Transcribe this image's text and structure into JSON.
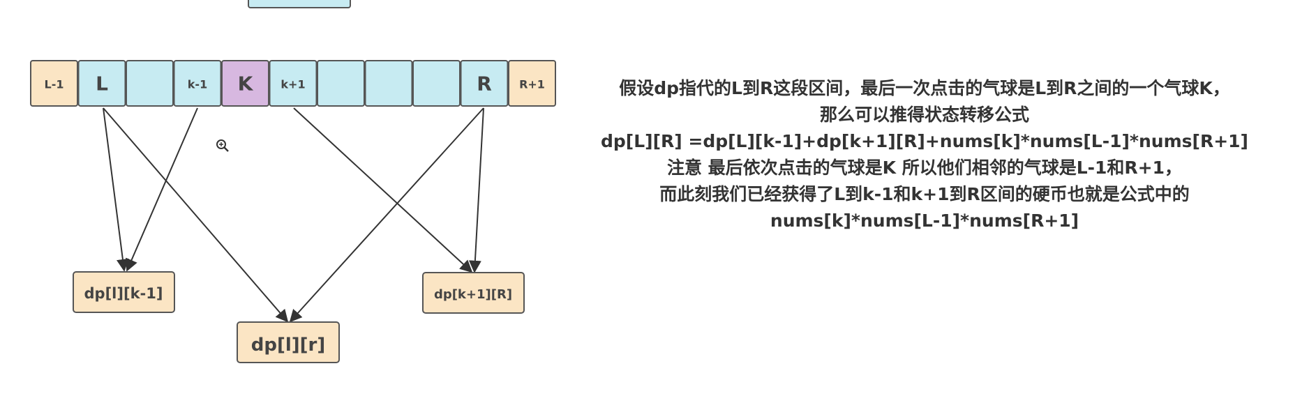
{
  "colors": {
    "cell_blue": "#c7ebf2",
    "cell_orange": "#fbe5c4",
    "cell_purple": "#d7b8e0",
    "border": "#555555",
    "text": "#444444"
  },
  "cells": [
    {
      "label": "L-1",
      "kind": "orange"
    },
    {
      "label": "L",
      "kind": "blue"
    },
    {
      "label": "",
      "kind": "blue"
    },
    {
      "label": "k-1",
      "kind": "blue"
    },
    {
      "label": "K",
      "kind": "purple"
    },
    {
      "label": "k+1",
      "kind": "blue"
    },
    {
      "label": "",
      "kind": "blue"
    },
    {
      "label": "",
      "kind": "blue"
    },
    {
      "label": "",
      "kind": "blue"
    },
    {
      "label": "R",
      "kind": "blue"
    },
    {
      "label": "R+1",
      "kind": "orange"
    }
  ],
  "result_boxes": {
    "left": "dp[l][k-1]",
    "center": "dp[l][r]",
    "right": "dp[k+1][R]"
  },
  "explanation_lines": [
    "假设dp指代的L到R这段区间，最后一次点击的气球是L到R之间的一个气球K，",
    "那么可以推得状态转移公式",
    "dp[L][R] =dp[L][k-1]+dp[k+1][R]+nums[k]*nums[L-1]*nums[R+1]",
    "注意 最后依次点击的气球是K 所以他们相邻的气球是L-1和R+1，",
    "而此刻我们已经获得了L到k-1和k+1到R区间的硬币也就是公式中的",
    "nums[k]*nums[L-1]*nums[R+1]"
  ],
  "icons": {
    "zoom_cursor": "zoom-in-cursor-icon"
  }
}
